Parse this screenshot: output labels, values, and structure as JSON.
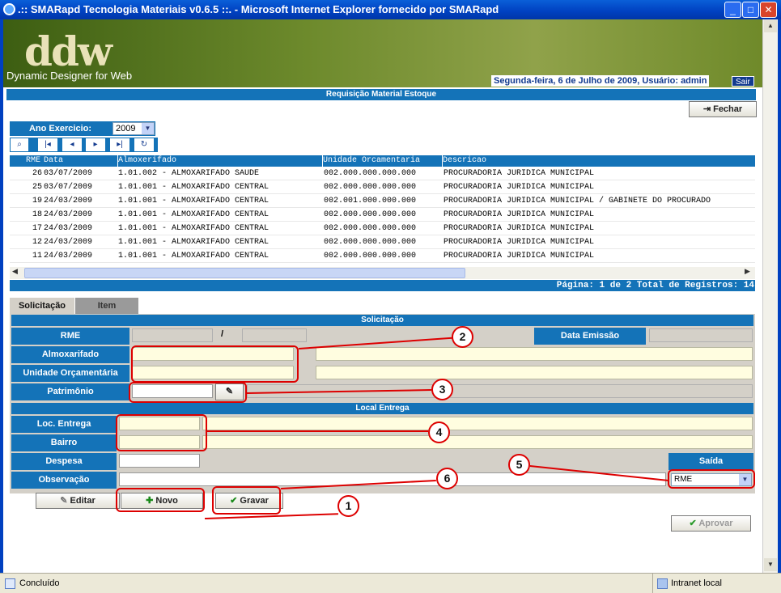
{
  "window": {
    "title": ".:: SMARapd Tecnologia Materiais v0.6.5 ::. - Microsoft Internet Explorer fornecido por SMARapd"
  },
  "banner": {
    "logo": "ddw",
    "subtitle": "Dynamic Designer for Web",
    "date_user": "Segunda-feira, 6 de Julho de 2009, Usuário: admin",
    "logout": "Sair"
  },
  "page": {
    "header": "Requisição Material Estoque",
    "close_label": "Fechar"
  },
  "year": {
    "label": "Ano Exercicio:",
    "value": "2009"
  },
  "grid": {
    "columns": [
      "RME",
      "Data",
      "Almoxerifado",
      "Unidade Orcamentaria",
      "Descricao"
    ],
    "rows": [
      {
        "rme": "26",
        "data": "03/07/2009",
        "almox": "1.01.002 - ALMOXARIFADO SAUDE",
        "unidade": "002.000.000.000.000",
        "descricao": "PROCURADORIA JURIDICA MUNICIPAL"
      },
      {
        "rme": "25",
        "data": "03/07/2009",
        "almox": "1.01.001 - ALMOXARIFADO CENTRAL",
        "unidade": "002.000.000.000.000",
        "descricao": "PROCURADORIA JURIDICA MUNICIPAL"
      },
      {
        "rme": "19",
        "data": "24/03/2009",
        "almox": "1.01.001 - ALMOXARIFADO CENTRAL",
        "unidade": "002.001.000.000.000",
        "descricao": "PROCURADORIA JURIDICA MUNICIPAL / GABINETE DO PROCURADO"
      },
      {
        "rme": "18",
        "data": "24/03/2009",
        "almox": "1.01.001 - ALMOXARIFADO CENTRAL",
        "unidade": "002.000.000.000.000",
        "descricao": "PROCURADORIA JURIDICA MUNICIPAL"
      },
      {
        "rme": "17",
        "data": "24/03/2009",
        "almox": "1.01.001 - ALMOXARIFADO CENTRAL",
        "unidade": "002.000.000.000.000",
        "descricao": "PROCURADORIA JURIDICA MUNICIPAL"
      },
      {
        "rme": "12",
        "data": "24/03/2009",
        "almox": "1.01.001 - ALMOXARIFADO CENTRAL",
        "unidade": "002.000.000.000.000",
        "descricao": "PROCURADORIA JURIDICA MUNICIPAL"
      },
      {
        "rme": "11",
        "data": "24/03/2009",
        "almox": "1.01.001 - ALMOXARIFADO CENTRAL",
        "unidade": "002.000.000.000.000",
        "descricao": "PROCURADORIA JURIDICA MUNICIPAL"
      }
    ],
    "pager": "Página: 1 de 2 Total de Registros: 14"
  },
  "tabs": [
    "Solicitação",
    "Item"
  ],
  "form": {
    "section_title": "Solicitação",
    "rme_label": "RME",
    "rme_separator": "/",
    "data_emissao_label": "Data Emissão",
    "almoxarifado_label": "Almoxarifado",
    "unidade_label": "Unidade Orçamentária",
    "patrimonio_label": "Patrimônio",
    "local_section": "Local Entrega",
    "loc_entrega_label": "Loc. Entrega",
    "bairro_label": "Bairro",
    "despesa_label": "Despesa",
    "observacao_label": "Observação",
    "saida_label": "Saída",
    "saida_value": "RME"
  },
  "buttons": {
    "editar": "Editar",
    "novo": "Novo",
    "gravar": "Gravar",
    "aprovar": "Aprovar"
  },
  "annotations": [
    "1",
    "2",
    "3",
    "4",
    "5",
    "6"
  ],
  "status": {
    "left": "Concluído",
    "right": "Intranet local"
  },
  "colors": {
    "header_blue": "#1473b8",
    "field_yellow": "#fffde0",
    "annotation_red": "#dd0000"
  }
}
